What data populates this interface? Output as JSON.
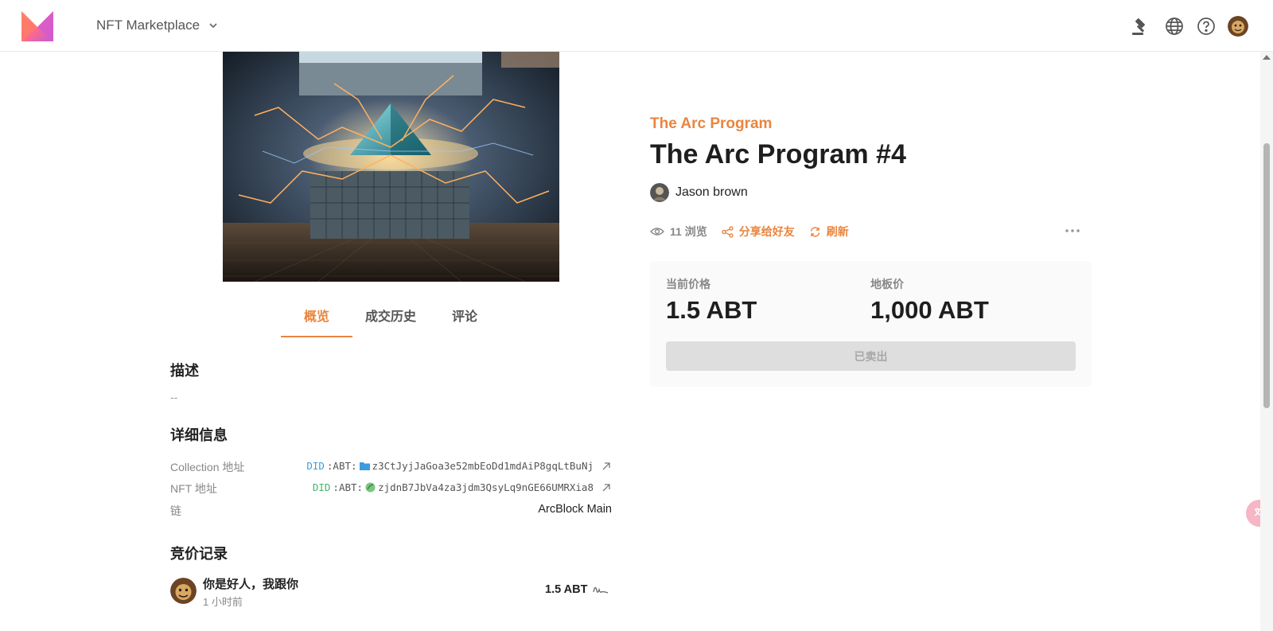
{
  "header": {
    "app_name": "NFT Marketplace",
    "icons": [
      "auction-icon",
      "globe-icon",
      "help-icon",
      "user-avatar"
    ]
  },
  "tabs": [
    {
      "label": "概览",
      "active": true
    },
    {
      "label": "成交历史",
      "active": false
    },
    {
      "label": "评论",
      "active": false
    }
  ],
  "description": {
    "title": "描述",
    "value": "--"
  },
  "details": {
    "title": "详细信息",
    "collection_label": "Collection 地址",
    "collection_prefix": "DID",
    "collection_sep": ":ABT:",
    "collection_address": "z3CtJyjJaGoa3e52mbEoDd1mdAiP8gqLtBuNj",
    "nft_label": "NFT 地址",
    "nft_prefix": "DID",
    "nft_sep": ":ABT:",
    "nft_address": "zjdnB7JbVa4za3jdm3QsyLq9nGE66UMRXia8",
    "chain_label": "链",
    "chain_value": "ArcBlock Main"
  },
  "bids": {
    "title": "竞价记录",
    "items": [
      {
        "name": "你是好人，我跟你",
        "time": "1 小时前",
        "amount": "1.5 ABT"
      }
    ]
  },
  "nft": {
    "collection": "The Arc Program",
    "title": "The Arc Program #4",
    "owner": "Jason brown",
    "views": "11 浏览",
    "share_label": "分享给好友",
    "refresh_label": "刷新"
  },
  "price": {
    "current_label": "当前价格",
    "current_value": "1.5 ABT",
    "floor_label": "地板价",
    "floor_value": "1,000 ABT",
    "button_label": "已卖出"
  },
  "colors": {
    "accent": "#e9853f",
    "did_blue": "#3c9ce0",
    "did_green": "#46b46a"
  }
}
